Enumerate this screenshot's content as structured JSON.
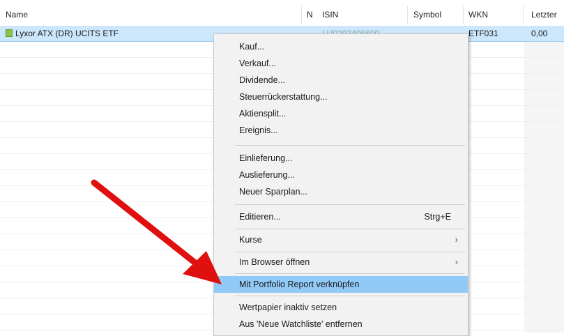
{
  "columns": {
    "name": "Name",
    "n": "N",
    "isin": "ISIN",
    "symbol": "Symbol",
    "wkn": "WKN",
    "last": "Letzter"
  },
  "rows": [
    {
      "name": "Lyxor ATX (DR) UCITS ETF",
      "isin": "LU0293406600",
      "wkn": "ETF031",
      "last": "0,00"
    }
  ],
  "menu": {
    "items": [
      {
        "label": "Kauf..."
      },
      {
        "label": "Verkauf..."
      },
      {
        "label": "Dividende..."
      },
      {
        "label": "Steuerrückerstattung..."
      },
      {
        "label": "Aktiensplit..."
      },
      {
        "label": "Ereignis..."
      },
      {
        "label": "Einlieferung..."
      },
      {
        "label": "Auslieferung..."
      },
      {
        "label": "Neuer Sparplan..."
      },
      {
        "label": "Editieren...",
        "shortcut": "Strg+E"
      },
      {
        "label": "Kurse",
        "submenu": "›"
      },
      {
        "label": "Im Browser öffnen",
        "submenu": "›"
      },
      {
        "label": "Mit Portfolio Report verknüpfen"
      },
      {
        "label": "Wertpapier inaktiv setzen"
      },
      {
        "label": "Aus 'Neue Watchliste' entfernen"
      }
    ]
  },
  "colors": {
    "highlight": "#91c9f7",
    "selected_row": "#cce6fb",
    "arrow": "#e01010"
  },
  "icons": {
    "security": "security-icon",
    "arrow": "red-arrow-annotation"
  }
}
